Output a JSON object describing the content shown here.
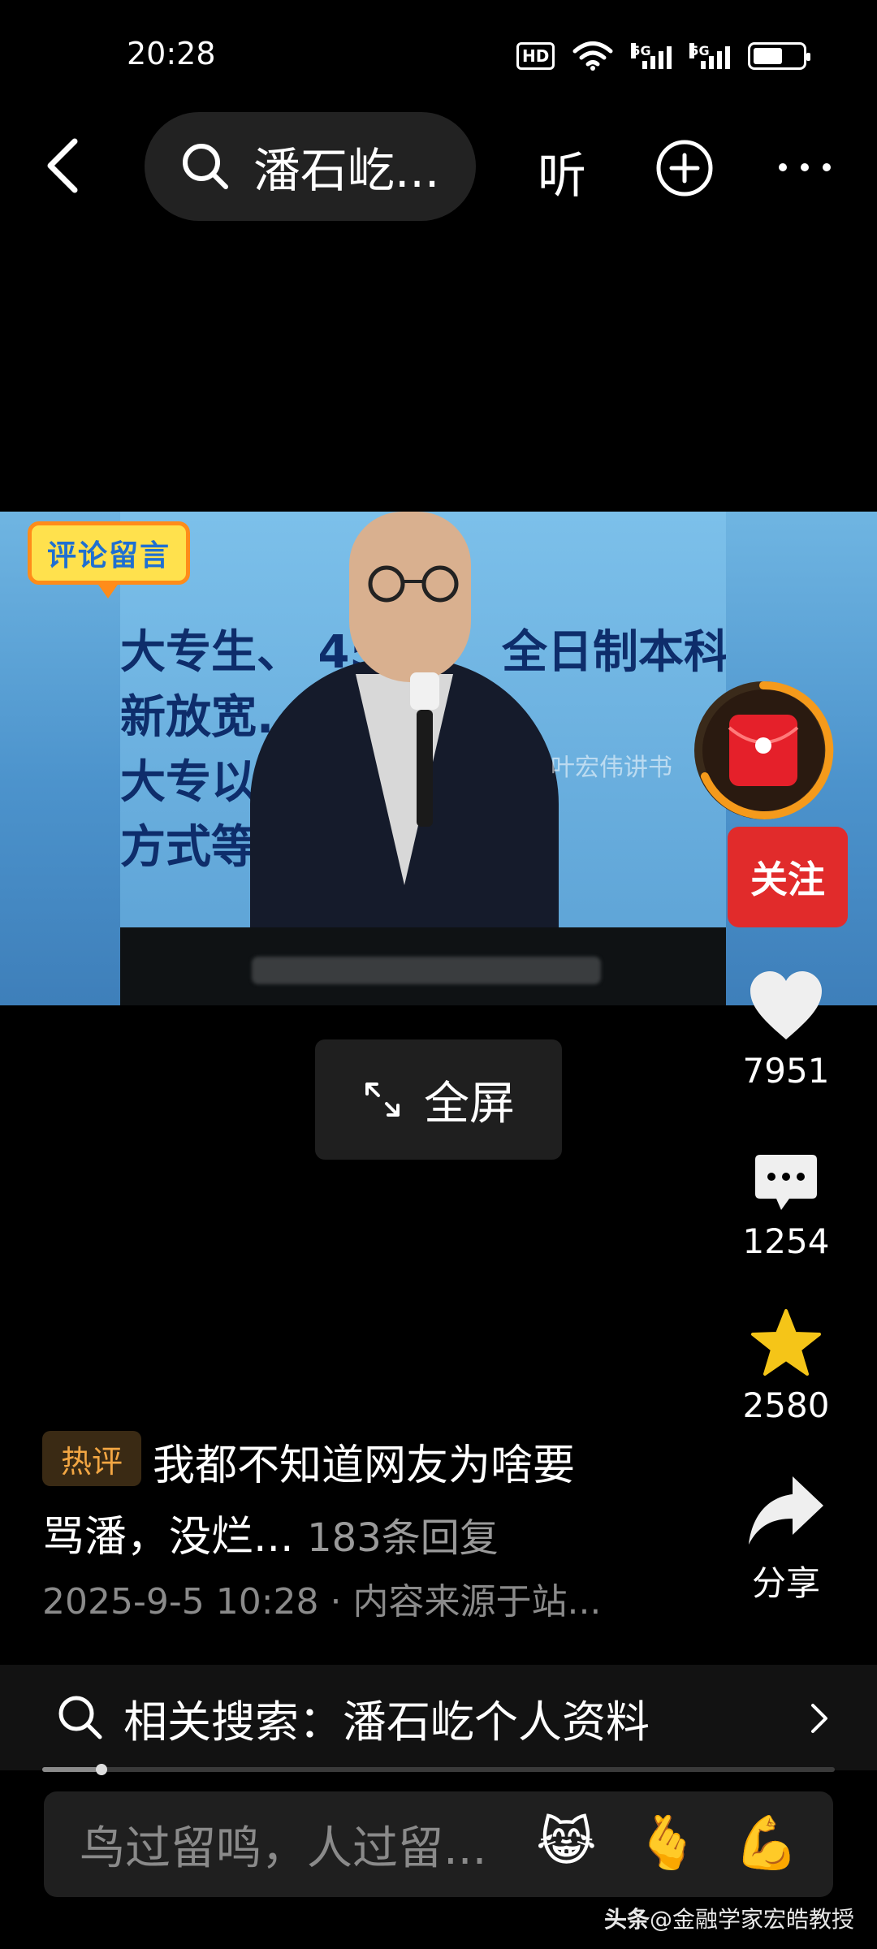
{
  "status_bar": {
    "time": "20:28",
    "icons": [
      "hd-voice-icon",
      "wifi-icon",
      "5g-signal-icon",
      "5g-signal-icon",
      "battery-icon"
    ],
    "hd_label": "HD",
    "network_label": "5G"
  },
  "top_bar": {
    "search_text": "潘石屹...",
    "listen_label": "听"
  },
  "video": {
    "badge_text": "评论留言",
    "bg_lines": [
      "大专生、 45",
      "全日制本科",
      "新放宽.",
      "大专以上",
      "方式等"
    ],
    "watermark": "叶宏伟讲书",
    "fullscreen_label": "全屏"
  },
  "right_rail": {
    "follow_label": "关注",
    "likes": "7951",
    "comments": "1254",
    "favorites": "2580",
    "share_label": "分享"
  },
  "hot_comment": {
    "tag": "热评",
    "line1": "我都不知道网友为啥要",
    "line2": "骂潘，没烂...",
    "replies": "183条回复",
    "meta": "2025-9-5 10:28 · 内容来源于站..."
  },
  "related_search": {
    "label": "相关搜索：潘石屹个人资料"
  },
  "progress": 0.07,
  "comment_input": {
    "placeholder": "鸟过留鸣，人过留...",
    "emojis": [
      "😹",
      "🫰",
      "💪"
    ]
  },
  "source_watermark": {
    "brand": "头条",
    "author": "@金融学家宏皓教授"
  },
  "colors": {
    "follow": "#e12b2b",
    "favorite_star": "#f5c518",
    "hot_tag_text": "#f2a643",
    "red_packet": "#e5202a"
  }
}
